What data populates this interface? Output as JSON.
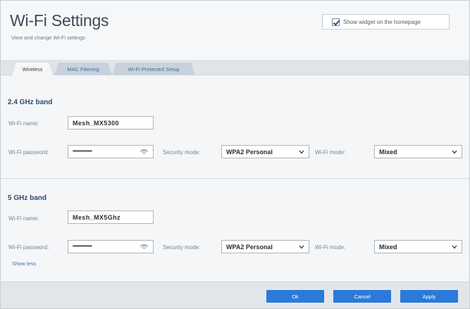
{
  "header": {
    "title": "Wi-Fi Settings",
    "subtitle": "View and change Wi-Fi settings",
    "widget_label": "Show widget on the homepage",
    "widget_checked": true
  },
  "tabs": [
    {
      "label": "Wireless",
      "active": true
    },
    {
      "label": "MAC Filtering",
      "active": false
    },
    {
      "label": "Wi-Fi Protected Setup",
      "active": false
    }
  ],
  "band_24": {
    "title": "2.4 GHz band",
    "wifi_name_label": "Wi-Fi name:",
    "wifi_name_value": "Mesh_MX5300",
    "wifi_password_label": "Wi-Fi password:",
    "wifi_password_value": "••••••••••••••",
    "security_mode_label": "Security mode:",
    "security_mode_value": "WPA2 Personal",
    "wifi_mode_label": "Wi-Fi mode:",
    "wifi_mode_value": "Mixed"
  },
  "band_5": {
    "title": "5 GHz band",
    "wifi_name_label": "Wi-Fi name:",
    "wifi_name_value": "Mesh_MX5Ghz",
    "wifi_password_label": "Wi-Fi password:",
    "wifi_password_value": "••••••••••••••",
    "security_mode_label": "Security mode:",
    "security_mode_value": "WPA2 Personal",
    "wifi_mode_label": "Wi-Fi mode:",
    "wifi_mode_value": "Mixed"
  },
  "show_less_label": "Show less",
  "footer": {
    "ok_label": "Ok",
    "cancel_label": "Cancel",
    "apply_label": "Apply"
  },
  "colors": {
    "accent": "#2b7ad9",
    "link": "#3b70b0",
    "section_title": "#2f4d6b"
  }
}
